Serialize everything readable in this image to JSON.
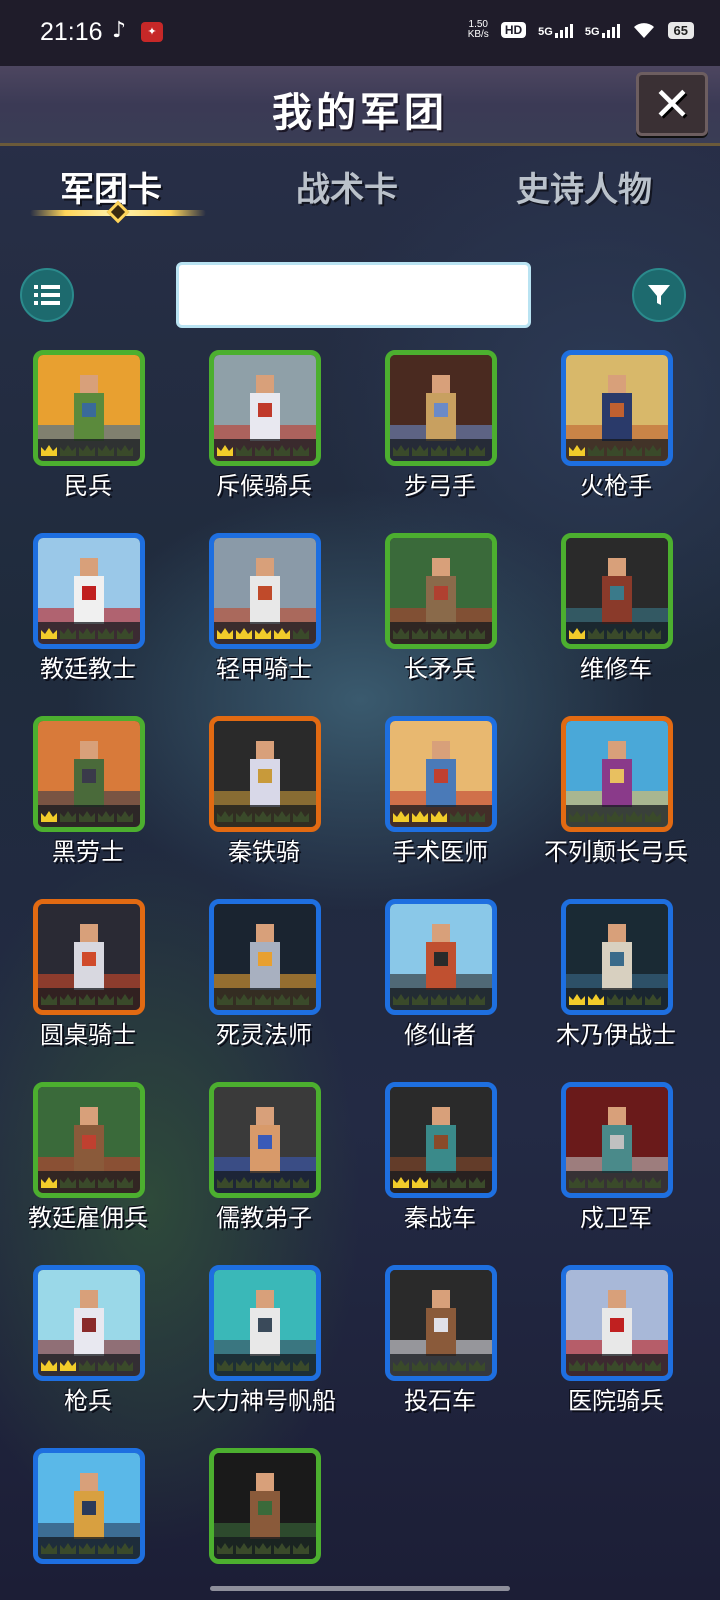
{
  "status": {
    "time": "21:16",
    "net_speed_top": "1.50",
    "net_speed_unit": "KB/s",
    "hd": "HD",
    "sig1": "5G",
    "sig2": "5G",
    "battery": "65"
  },
  "header": {
    "title": "我的军团",
    "close_label": "✕"
  },
  "tabs": [
    {
      "label": "军团卡",
      "active": true
    },
    {
      "label": "战术卡",
      "active": false
    },
    {
      "label": "史诗人物",
      "active": false
    }
  ],
  "search": {
    "value": "",
    "placeholder": ""
  },
  "cards": [
    {
      "name": "民兵",
      "rarity": "green",
      "crowns_gold": 1,
      "colors": [
        "#e8a030",
        "#5b8a3c",
        "#3a6a9a"
      ]
    },
    {
      "name": "斥候骑兵",
      "rarity": "green",
      "crowns_gold": 1,
      "colors": [
        "#8fa0a8",
        "#e8e8f0",
        "#c0392b"
      ]
    },
    {
      "name": "步弓手",
      "rarity": "green",
      "crowns_gold": 0,
      "colors": [
        "#4a2a20",
        "#c8a060",
        "#6a8ac8"
      ]
    },
    {
      "name": "火枪手",
      "rarity": "blue",
      "crowns_gold": 1,
      "colors": [
        "#d8b86a",
        "#2a3a6a",
        "#c06030"
      ]
    },
    {
      "name": "教廷教士",
      "rarity": "blue",
      "crowns_gold": 1,
      "colors": [
        "#9ac8e8",
        "#f0f0f0",
        "#c02020"
      ]
    },
    {
      "name": "轻甲骑士",
      "rarity": "blue",
      "crowns_gold": 4,
      "colors": [
        "#8a9aa8",
        "#e8e8e8",
        "#c04a2a"
      ]
    },
    {
      "name": "长矛兵",
      "rarity": "green",
      "crowns_gold": 0,
      "colors": [
        "#3a6a3a",
        "#8a6a4a",
        "#b04030"
      ]
    },
    {
      "name": "维修车",
      "rarity": "green",
      "crowns_gold": 1,
      "colors": [
        "#2a2a2a",
        "#8a3a2a",
        "#3a7a8a"
      ]
    },
    {
      "name": "黑劳士",
      "rarity": "green",
      "crowns_gold": 1,
      "colors": [
        "#d87a3a",
        "#4a6a3a",
        "#3a3a4a"
      ]
    },
    {
      "name": "秦铁骑",
      "rarity": "orange",
      "crowns_gold": 0,
      "colors": [
        "#2a2a2a",
        "#d8d8e8",
        "#c89a3a"
      ]
    },
    {
      "name": "手术医师",
      "rarity": "blue",
      "crowns_gold": 3,
      "colors": [
        "#e8b870",
        "#4a7ab8",
        "#c04030"
      ]
    },
    {
      "name": "不列颠长弓兵",
      "rarity": "orange",
      "crowns_gold": 0,
      "colors": [
        "#4aa8d8",
        "#8a3a8a",
        "#e8c060"
      ]
    },
    {
      "name": "圆桌骑士",
      "rarity": "orange",
      "crowns_gold": 0,
      "colors": [
        "#2a2a34",
        "#d8d8e0",
        "#d04a2a"
      ]
    },
    {
      "name": "死灵法师",
      "rarity": "blue",
      "crowns_gold": 0,
      "colors": [
        "#1a2430",
        "#a8b0c0",
        "#e8a030"
      ]
    },
    {
      "name": "修仙者",
      "rarity": "blue",
      "crowns_gold": 0,
      "colors": [
        "#8ac8e8",
        "#c05030",
        "#2a2a2a"
      ]
    },
    {
      "name": "木乃伊战士",
      "rarity": "blue",
      "crowns_gold": 2,
      "colors": [
        "#1a2a34",
        "#d8d0c0",
        "#3a6a8a"
      ]
    },
    {
      "name": "教廷雇佣兵",
      "rarity": "green",
      "crowns_gold": 1,
      "colors": [
        "#3a6a3a",
        "#8a5a3a",
        "#c04030"
      ]
    },
    {
      "name": "儒教弟子",
      "rarity": "green",
      "crowns_gold": 0,
      "colors": [
        "#3a3a3a",
        "#d89a6a",
        "#3a5ab8"
      ]
    },
    {
      "name": "秦战车",
      "rarity": "blue",
      "crowns_gold": 2,
      "colors": [
        "#2a2a2a",
        "#3a8a8a",
        "#8a4a2a"
      ]
    },
    {
      "name": "戍卫军",
      "rarity": "blue",
      "crowns_gold": 0,
      "colors": [
        "#6a1a1a",
        "#4a8a8a",
        "#c0c0c0"
      ]
    },
    {
      "name": "枪兵",
      "rarity": "blue",
      "crowns_gold": 2,
      "colors": [
        "#9ad8e8",
        "#e8e8f0",
        "#8a2a2a"
      ]
    },
    {
      "name": "大力神号帆船",
      "rarity": "blue",
      "crowns_gold": 0,
      "colors": [
        "#3ab8b8",
        "#e8e8e8",
        "#3a4a5a"
      ]
    },
    {
      "name": "投石车",
      "rarity": "blue",
      "crowns_gold": 0,
      "colors": [
        "#2a2a2a",
        "#8a5a3a",
        "#e0e0e8"
      ]
    },
    {
      "name": "医院骑兵",
      "rarity": "blue",
      "crowns_gold": 0,
      "colors": [
        "#a8b8d8",
        "#e8e8e8",
        "#c02020"
      ]
    },
    {
      "name": "",
      "rarity": "blue",
      "crowns_gold": 0,
      "colors": [
        "#5ab8e8",
        "#d8a040",
        "#2a3a5a"
      ]
    },
    {
      "name": "",
      "rarity": "green",
      "crowns_gold": 0,
      "colors": [
        "#1a1a1a",
        "#8a5a3a",
        "#3a6a3a"
      ]
    }
  ]
}
